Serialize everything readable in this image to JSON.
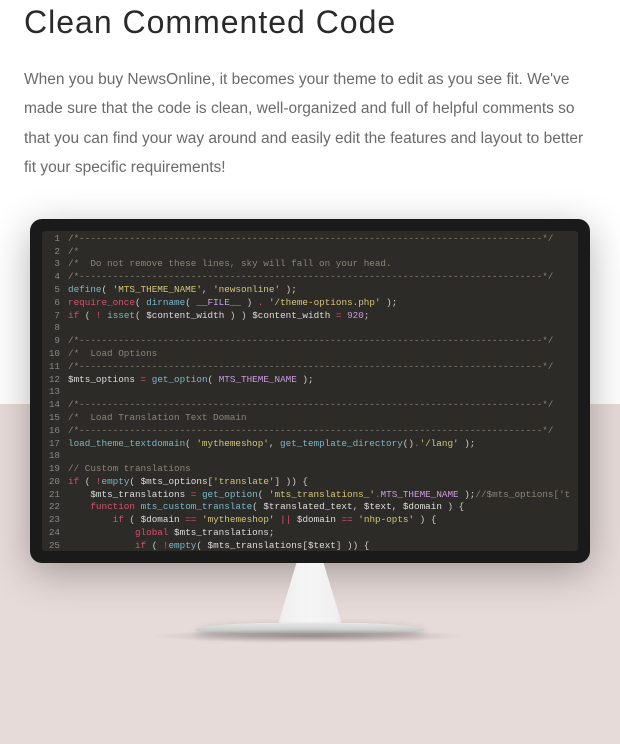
{
  "heading": "Clean Commented Code",
  "description": "When you buy NewsOnline, it becomes your theme to edit as you see fit. We've made sure that the code is clean, well-organized and full of helpful comments so that you can find your way around and easily edit the features and layout to better fit your specific requirements!",
  "code": {
    "lines": [
      {
        "n": 1,
        "t": "/*-----------------------------------------------------------------------------------*/",
        "c": "cm"
      },
      {
        "n": 2,
        "t": "/*",
        "c": "cm"
      },
      {
        "n": 3,
        "t": "/*  Do not remove these lines, sky will fall on your head.",
        "c": "cm"
      },
      {
        "n": 4,
        "t": "/*-----------------------------------------------------------------------------------*/",
        "c": "cm"
      },
      {
        "n": 5,
        "html": "<span class='fn'>define</span>( <span class='str'>'MTS_THEME_NAME'</span>, <span class='str'>'newsonline'</span> );"
      },
      {
        "n": 6,
        "html": "<span class='kw'>require_once</span>( <span class='fn'>dirname</span>( <span class='con'>__FILE__</span> ) <span class='op'>.</span> <span class='str'>'/theme-options.php'</span> );"
      },
      {
        "n": 7,
        "html": "<span class='kw'>if</span> ( <span class='op'>!</span> <span class='fn'>isset</span>( <span class='var'>$content_width</span> ) ) <span class='var'>$content_width</span> <span class='op'>=</span> <span class='num'>920</span>;"
      },
      {
        "n": 8,
        "t": ""
      },
      {
        "n": 9,
        "t": "/*-----------------------------------------------------------------------------------*/",
        "c": "cm"
      },
      {
        "n": 10,
        "t": "/*  Load Options",
        "c": "cm"
      },
      {
        "n": 11,
        "t": "/*-----------------------------------------------------------------------------------*/",
        "c": "cm"
      },
      {
        "n": 12,
        "html": "<span class='var'>$mts_options</span> <span class='op'>=</span> <span class='fn'>get_option</span>( <span class='con'>MTS_THEME_NAME</span> );"
      },
      {
        "n": 13,
        "t": ""
      },
      {
        "n": 14,
        "t": "/*-----------------------------------------------------------------------------------*/",
        "c": "cm"
      },
      {
        "n": 15,
        "t": "/*  Load Translation Text Domain",
        "c": "cm"
      },
      {
        "n": 16,
        "t": "/*-----------------------------------------------------------------------------------*/",
        "c": "cm"
      },
      {
        "n": 17,
        "html": "<span class='fn'>load_theme_textdomain</span>( <span class='str'>'mythemeshop'</span>, <span class='fn'>get_template_directory</span>()<span class='op'>.</span><span class='str'>'/lang'</span> );"
      },
      {
        "n": 18,
        "t": ""
      },
      {
        "n": 19,
        "t": "// Custom translations",
        "c": "cm"
      },
      {
        "n": 20,
        "html": "<span class='kw'>if</span> ( <span class='op'>!</span><span class='fn'>empty</span>( <span class='var'>$mts_options</span>[<span class='str'>'translate'</span>] )) {"
      },
      {
        "n": 21,
        "html": "    <span class='var'>$mts_translations</span> <span class='op'>=</span> <span class='fn'>get_option</span>( <span class='str'>'mts_translations_'</span><span class='op'>.</span><span class='con'>MTS_THEME_NAME</span> );<span class='cm'>//$mts_options['t</span>"
      },
      {
        "n": 22,
        "html": "    <span class='kw'>function</span> <span class='fn'>mts_custom_translate</span>( <span class='var'>$translated_text</span>, <span class='var'>$text</span>, <span class='var'>$domain</span> ) {"
      },
      {
        "n": 23,
        "html": "        <span class='kw'>if</span> ( <span class='var'>$domain</span> <span class='op'>==</span> <span class='str'>'mythemeshop'</span> <span class='op'>||</span> <span class='var'>$domain</span> <span class='op'>==</span> <span class='str'>'nhp-opts'</span> ) {"
      },
      {
        "n": 24,
        "html": "            <span class='kw'>global</span> <span class='var'>$mts_translations</span>;"
      },
      {
        "n": 25,
        "html": "            <span class='kw'>if</span> ( <span class='op'>!</span><span class='fn'>empty</span>( <span class='var'>$mts_translations</span>[<span class='var'>$text</span>] )) {"
      }
    ]
  }
}
